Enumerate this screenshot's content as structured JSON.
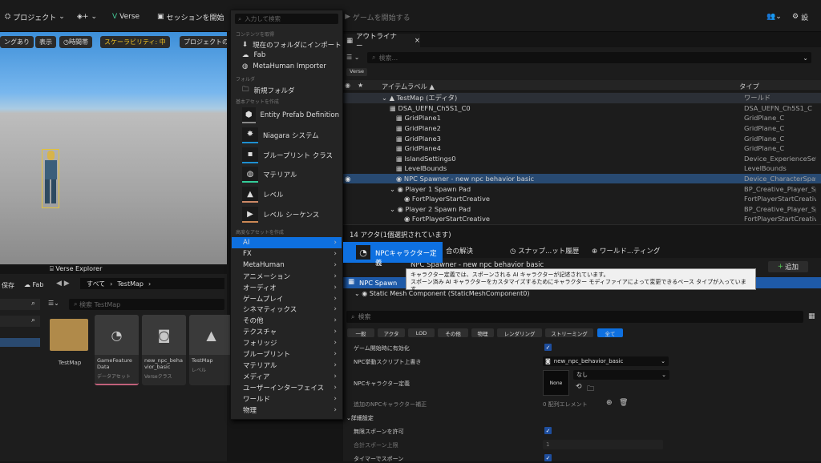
{
  "toolbar": {
    "project": "プロジェクト",
    "verse": "Verse",
    "session": "セッションを開始",
    "game_start": "ゲームを開始する",
    "settings": "設"
  },
  "viewport": {
    "b1": "ングあり",
    "b2": "表示",
    "b3": "時間帯",
    "scalability": "スケーラビリティ: 中",
    "b5": "プロジェクトの"
  },
  "menu": {
    "search_placeholder": "入力して検索",
    "h_content": "コンテンツを取得",
    "import": "現在のフォルダにインポート",
    "fab": "Fab",
    "metahuman_importer": "MetaHuman Importer",
    "h_folder": "フォルダ",
    "new_folder": "新規フォルダ",
    "h_basic": "基本アセットを作成",
    "basic": [
      "Entity Prefab Definition",
      "Niagara システム",
      "ブループリント クラス",
      "マテリアル",
      "レベル",
      "レベル シーケンス"
    ],
    "h_advanced": "高度なアセットを作成",
    "categories": [
      "AI",
      "FX",
      "MetaHuman",
      "アニメーション",
      "オーディオ",
      "ゲームプレイ",
      "シネマティックス",
      "その他",
      "テクスチャ",
      "フォリッジ",
      "ブループリント",
      "マテリアル",
      "メディア",
      "ユーザーインターフェイス",
      "ワールド",
      "物理"
    ]
  },
  "submenu": {
    "npc_def": "NPCキャラクター定義"
  },
  "tooltip": {
    "line1": "キャラクター定義では、スポーンされる AI キャラクターが記述されています。",
    "line2": "スポーン済み AI キャラクターをカスタマイズするためにキャラクター モディファイアによって変更できるベース タイプが入っています"
  },
  "outliner": {
    "tab": "アウトライナー",
    "search_placeholder": "検索...",
    "verse_chip": "Verse",
    "col_label": "アイテムラベル ▲",
    "col_type": "タイプ",
    "rows": [
      {
        "label": "TestMap (エディタ)",
        "type": "ワールド"
      },
      {
        "label": "DSA_UEFN_Ch5S1_C0",
        "type": "DSA_UEFN_Ch5S1_C"
      },
      {
        "label": "GridPlane1",
        "type": "GridPlane_C"
      },
      {
        "label": "GridPlane2",
        "type": "GridPlane_C"
      },
      {
        "label": "GridPlane3",
        "type": "GridPlane_C"
      },
      {
        "label": "GridPlane4",
        "type": "GridPlane_C"
      },
      {
        "label": "IslandSettings0",
        "type": "Device_ExperienceSett"
      },
      {
        "label": "LevelBounds",
        "type": "LevelBounds"
      },
      {
        "label": "NPC Spawner - new npc behavior basic",
        "type": "Device_CharacterSpaw"
      },
      {
        "label": "Player 1 Spawn Pad",
        "type": "BP_Creative_Player_Sp"
      },
      {
        "label": "FortPlayerStartCreative",
        "type": "FortPlayerStartCreativ"
      },
      {
        "label": "Player 2 Spawn Pad",
        "type": "BP_Creative_Player_Sp"
      },
      {
        "label": "FortPlayerStartCreative",
        "type": "FortPlayerStartCreativ"
      }
    ],
    "status": "14 アクタ(1個選択されています)"
  },
  "mid_tabs": {
    "merge": "合の解決",
    "snapshot": "スナップ...ット履歴",
    "world": "ワールド...ティング"
  },
  "details": {
    "add": "追加",
    "header_actor": "NPC Spawner - new npc behavior basic",
    "comp1": "NPC Spawn",
    "comp2": "Static Mesh Component (StaticMeshComponent0)",
    "search_placeholder": "検索",
    "tabs": [
      "一般",
      "アクタ",
      "LOD",
      "その他",
      "物理",
      "レンダリング",
      "ストリーミング",
      "全て"
    ],
    "p_enable": "ゲーム開始時に有効化",
    "p_script": "NPC挙動スクリプト上書き",
    "p_script_val": "new_npc_behavior_basic",
    "p_def": "NPCキャラクター定義",
    "p_def_val": "なし",
    "p_def_thumb": "None",
    "p_extra": "追加のNPCキャラクター補正",
    "p_extra_val": "0 配列エレメント",
    "section": "詳細設定",
    "p_infinite": "無限スポーンを許可",
    "p_total": "合計スポーン上限",
    "p_total_val": "1",
    "p_timer": "タイマーでスポーン"
  },
  "bottom": {
    "verse_explorer": "Verse Explorer",
    "save": "保存",
    "fab": "Fab",
    "path_all": "すべて",
    "path_map": "TestMap",
    "search_placeholder": "検索 TestMap",
    "assets": [
      {
        "name": "TestMap",
        "sub": ""
      },
      {
        "name": "GameFeature Data",
        "sub": "データアセット"
      },
      {
        "name": "new_npc_behavior_basic",
        "sub": "Verseクラス"
      },
      {
        "name": "TestMap",
        "sub": "レベル"
      }
    ]
  },
  "colors": {
    "accent": "#0e70e0",
    "folder": "#b08a4a",
    "select": "#1e5aa8"
  }
}
